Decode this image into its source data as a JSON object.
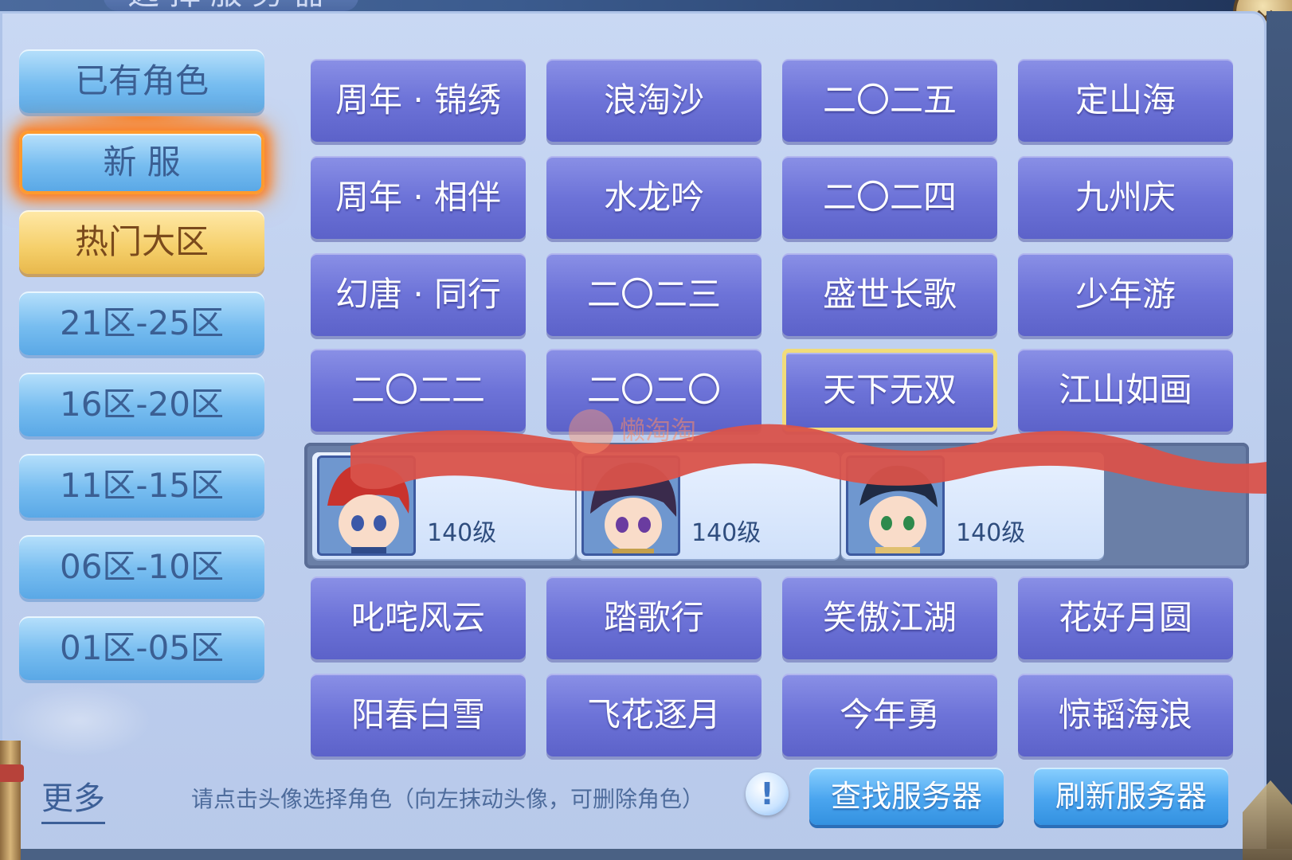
{
  "header": {
    "title": "选择服务器"
  },
  "left_tabs": [
    {
      "label": "已有角色"
    },
    {
      "label": "新 服"
    },
    {
      "label": "热门大区"
    },
    {
      "label": "21区-25区"
    },
    {
      "label": "16区-20区"
    },
    {
      "label": "11区-15区"
    },
    {
      "label": "06区-10区"
    },
    {
      "label": "01区-05区"
    }
  ],
  "servers_top": [
    [
      "周年 · 锦绣",
      "浪淘沙",
      "二〇二五",
      "定山海"
    ],
    [
      "周年 · 相伴",
      "水龙吟",
      "二〇二四",
      "九州庆"
    ],
    [
      "幻唐 · 同行",
      "二〇二三",
      "盛世长歌",
      "少年游"
    ],
    [
      "二〇二二",
      "二〇二〇",
      "天下无双",
      "江山如画"
    ]
  ],
  "selected_server": "天下无双",
  "characters": [
    {
      "level": "140级"
    },
    {
      "level": "140级"
    },
    {
      "level": "140级"
    }
  ],
  "servers_bottom": [
    [
      "叱咤风云",
      "踏歌行",
      "笑傲江湖",
      "花好月圆"
    ],
    [
      "阳春白雪",
      "飞花逐月",
      "今年勇",
      "惊韬海浪"
    ]
  ],
  "footer": {
    "more": "更多",
    "hint": "请点击头像选择角色（向左抹动头像，可删除角色）",
    "info": "!",
    "find_button": "查找服务器",
    "refresh_button": "刷新服务器"
  },
  "watermark": "懒淘淘"
}
